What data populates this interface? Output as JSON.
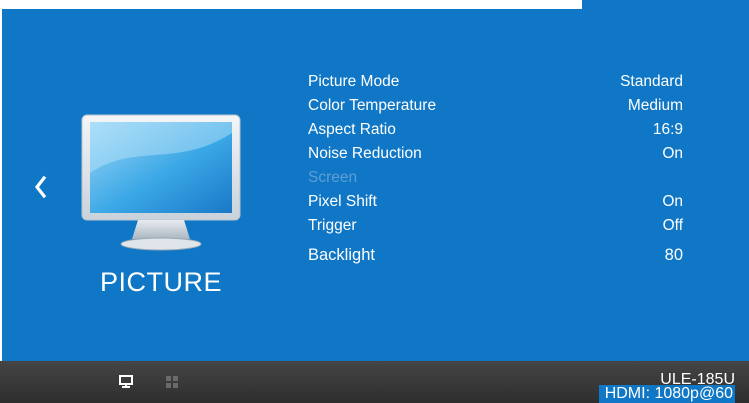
{
  "section": {
    "title": "PICTURE"
  },
  "menu": [
    {
      "label": "Picture Mode",
      "value": "Standard",
      "enabled": true
    },
    {
      "label": "Color Temperature",
      "value": "Medium",
      "enabled": true
    },
    {
      "label": "Aspect Ratio",
      "value": "16:9",
      "enabled": true
    },
    {
      "label": "Noise Reduction",
      "value": "On",
      "enabled": true
    },
    {
      "label": "Screen",
      "value": "",
      "enabled": false
    },
    {
      "label": "Pixel Shift",
      "value": "On",
      "enabled": true
    },
    {
      "label": "Trigger",
      "value": "Off",
      "enabled": true
    },
    {
      "label": "Backlight",
      "value": "80",
      "enabled": true
    }
  ],
  "statusbar": {
    "model": "ULE-185U",
    "input": "HDMI: 1080p@60"
  },
  "icons": {
    "back": "chevron-left-icon",
    "section": "monitor-icon",
    "tab_picture": "monitor-small-icon",
    "tab_grid": "grid-icon"
  },
  "colors": {
    "panel": "#0f77c6",
    "bar": "#3a3a3a",
    "text": "#ffffff",
    "disabled": "#5e9ed5"
  }
}
